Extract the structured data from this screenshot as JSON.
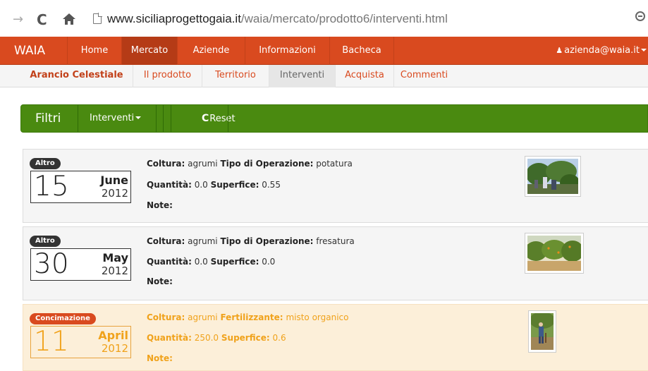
{
  "browser": {
    "url_host": "www.siciliaprogettogaia.it",
    "url_path": "/waia/mercato/prodotto6/interventi.html"
  },
  "navbar": {
    "brand": "WAIA",
    "items": [
      "Home",
      "Mercato",
      "Aziende",
      "Informazioni",
      "Bacheca"
    ],
    "active": "Mercato",
    "user": "azienda@waia.it"
  },
  "subnav": {
    "brand": "Arancio Celestiale",
    "items": [
      "Il prodotto",
      "Territorio",
      "Interventi",
      "Acquista",
      "Commenti"
    ],
    "active": "Interventi"
  },
  "filters": {
    "title": "Filtri",
    "dropdown": "Interventi",
    "reset": "Reset"
  },
  "labels": {
    "coltura": "Coltura:",
    "tipo_operazione": "Tipo di Operazione:",
    "fertilizzante": "Fertilizzante:",
    "quantita": "Quantità:",
    "superfice": "Superfice:",
    "note": "Note:"
  },
  "interventions": [
    {
      "badge": "Altro",
      "day": "15",
      "month": "June",
      "year": "2012",
      "coltura": "agrumi",
      "operazione": "potatura",
      "quantita": "0.0",
      "superfice": "0.55"
    },
    {
      "badge": "Altro",
      "day": "30",
      "month": "May",
      "year": "2012",
      "coltura": "agrumi",
      "operazione": "fresatura",
      "quantita": "0.0",
      "superfice": "0.0"
    },
    {
      "badge": "Concimazione",
      "day": "11",
      "month": "April",
      "year": "2012",
      "coltura": "agrumi",
      "fertilizzante": "misto organico",
      "quantita": "250.0",
      "superfice": "0.6"
    }
  ],
  "colors": {
    "navbar": "#d94a1f",
    "filterbar": "#4a8a10",
    "concimazione_bg": "#fcefd9",
    "concimazione_text": "#f0a21b"
  }
}
